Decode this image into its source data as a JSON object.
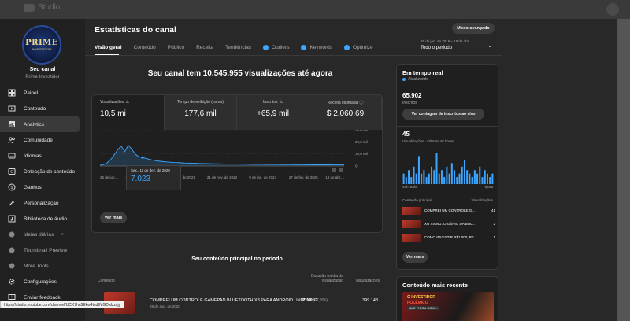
{
  "browser": {
    "title": "Studio"
  },
  "sidebar": {
    "logo_line1": "PRIME",
    "logo_line2": "INVESTIDOR",
    "channel_name": "Seu canal",
    "channel_handle": "Prime Investidor",
    "items": [
      {
        "label": "Painel",
        "icon": "dashboard-icon"
      },
      {
        "label": "Conteúdo",
        "icon": "content-icon"
      },
      {
        "label": "Analytics",
        "icon": "analytics-icon",
        "active": true
      },
      {
        "label": "Comunidade",
        "icon": "community-icon"
      },
      {
        "label": "Idiomas",
        "icon": "subtitles-icon"
      },
      {
        "label": "Detecção de conteúdo",
        "icon": "copyright-icon"
      },
      {
        "label": "Ganhos",
        "icon": "earn-icon"
      },
      {
        "label": "Personalização",
        "icon": "customization-icon"
      },
      {
        "label": "Biblioteca de áudio",
        "icon": "audio-library-icon"
      },
      {
        "label": "Ideias diárias",
        "icon": "ideas-icon",
        "dim": true
      },
      {
        "label": "Thumbnail Preview",
        "icon": "thumbnail-icon",
        "dim": true
      },
      {
        "label": "More Tools",
        "icon": "tools-icon",
        "dim": true
      },
      {
        "label": "Configurações",
        "icon": "gear-icon"
      },
      {
        "label": "Enviar feedback",
        "icon": "feedback-icon"
      }
    ]
  },
  "header": {
    "title": "Estatísticas do canal",
    "advanced_mode": "Modo avançado",
    "date_range": "25 de jan. de 2019 – 18 de abr. ...",
    "period": "Todo o período"
  },
  "tabs": [
    {
      "label": "Visão geral",
      "active": true
    },
    {
      "label": "Conteúdo"
    },
    {
      "label": "Público"
    },
    {
      "label": "Receita"
    },
    {
      "label": "Tendências"
    },
    {
      "label": "Outliers",
      "dot": true
    },
    {
      "label": "Keywords",
      "dot": true
    },
    {
      "label": "Optimize",
      "dot": true
    }
  ],
  "headline": "Seu canal tem 10.545.955 visualizações até agora",
  "metrics": [
    {
      "label": "Visualizações",
      "value": "10,5 mi",
      "warn": true
    },
    {
      "label": "Tempo de exibição (horas)",
      "value": "177,6 mil"
    },
    {
      "label": "Inscritos",
      "value": "+65,9 mil",
      "warn": true
    },
    {
      "label": "Receita estimada",
      "value": "$ 2.060,69",
      "info": true
    }
  ],
  "tooltip": {
    "date": "Sex., 11 de dez. de 2020",
    "value": "7.023"
  },
  "chart_data": {
    "type": "area",
    "title": "",
    "xlabel": "",
    "ylabel": "",
    "x_ticks": [
      "25 de jun....",
      "13 de ago. de 2020",
      "2 de out. de 2021",
      "21 de nov. de 2022",
      "9 de jan. de 2024",
      "27 de fev. de 2025",
      "18 de abr...."
    ],
    "y_ticks": [
      "0",
      "10,0 mil",
      "20,0 mil",
      "30,0 mil"
    ],
    "ylim": [
      0,
      30000
    ],
    "grid": true,
    "series": [
      {
        "values": [
          600,
          1200,
          2600,
          5200,
          9200,
          13500,
          16500,
          11800,
          17200,
          13800,
          9800,
          7600,
          7023,
          6300,
          5400,
          4800,
          4300,
          3900,
          3600,
          3300,
          3100,
          2900,
          2800,
          2600,
          2500,
          2400,
          2300,
          2200,
          2100,
          2000,
          1950,
          1900,
          1850,
          1800,
          1750,
          1700,
          1650,
          1600,
          1600,
          1550,
          1500,
          1500,
          1450,
          1400,
          1400,
          1350,
          1350,
          1300,
          1300,
          1250,
          1250,
          1200,
          1200,
          1150,
          1150,
          1100,
          1100,
          1100,
          1050,
          1050,
          1000,
          1000,
          1000,
          950,
          950,
          950,
          900,
          900,
          900,
          900
        ]
      }
    ]
  },
  "chart_see_more": "Ver mais",
  "top_content": {
    "title": "Seu conteúdo principal no período",
    "col_content": "Conteúdo",
    "col_duration": "Duração média da visualização",
    "col_views": "Visualizações",
    "rows": [
      {
        "title": "COMPREI UM CONTROLE GAMEPAD BLUETOOTH X3 PARA ANDROID UNBOXING",
        "date": "29 de ago. de 2020",
        "duration": "2:19",
        "duration_pct": "(27,5%)",
        "views": "399.148"
      }
    ]
  },
  "realtime": {
    "title": "Em tempo real",
    "live_label": "Atualizando",
    "subscribers": "65.902",
    "subscribers_label": "Inscritos",
    "live_count_button": "Ver contagem de inscritos ao vivo",
    "views_48": "45",
    "views_48_label": "Visualizações · Últimas 48 horas",
    "axis_left": "48h atrás",
    "axis_right": "Agora",
    "bars": [
      3,
      2,
      4,
      2,
      5,
      3,
      8,
      3,
      4,
      2,
      3,
      5,
      4,
      9,
      3,
      4,
      2,
      5,
      3,
      6,
      4,
      2,
      3,
      5,
      7,
      4,
      3,
      2,
      4,
      3,
      5,
      2,
      4,
      3,
      2,
      3
    ],
    "top_header": "Conteúdo principal",
    "top_header_right": "Visualizações",
    "top_rows": [
      {
        "title": "COMPREI UM CONTROLE G...",
        "views": "41"
      },
      {
        "title": "XU XIANG: O GÊNIO DA BOL...",
        "views": "2"
      },
      {
        "title": "COMO INVESTIR R$1.000, R$...",
        "views": "1"
      }
    ],
    "see_more": "Ver mais"
  },
  "recent": {
    "title": "Conteúdo mais recente",
    "thumb_line1": "O INVESTIDOR",
    "thumb_line2": "POLÊMICO",
    "thumb_line3": "QUE FICOU COM ..."
  },
  "status_url": "https://studio.youtube.com/channel/UCK7hn3Ekw4tcd9VGDaIzzcjy"
}
